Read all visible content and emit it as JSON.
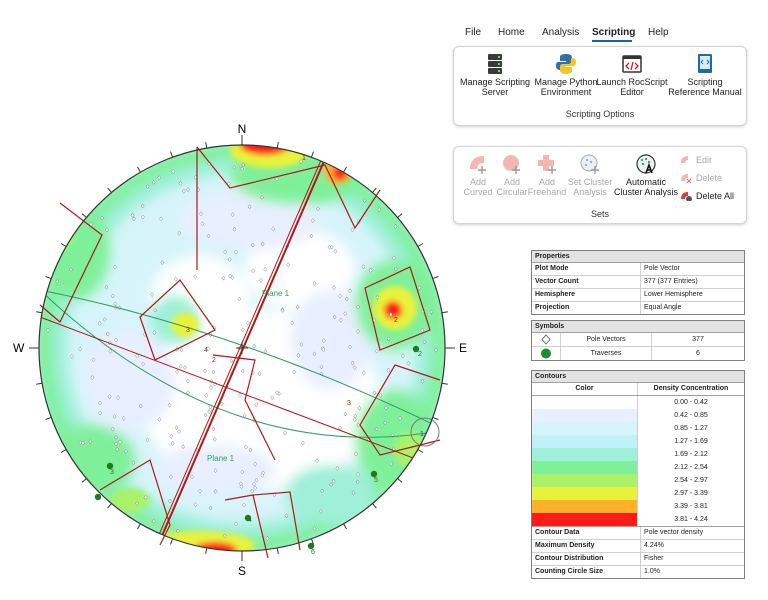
{
  "ribbon": {
    "menu": [
      {
        "label": "File",
        "active": false
      },
      {
        "label": "Home",
        "active": false
      },
      {
        "label": "Analysis",
        "active": false
      },
      {
        "label": "Scripting",
        "active": true
      },
      {
        "label": "Help",
        "active": false
      }
    ],
    "scripting": {
      "buttons": [
        {
          "line1": "Manage Scripting",
          "line2": "Server",
          "icon": "server-icon"
        },
        {
          "line1": "Manage Python",
          "line2": "Environment",
          "icon": "python-icon"
        },
        {
          "line1": "Launch RocScript",
          "line2": "Editor",
          "icon": "code-editor-icon"
        },
        {
          "line1": "Scripting",
          "line2": "Reference Manual",
          "icon": "manual-icon"
        }
      ],
      "group_label": "Scripting Options"
    },
    "sets": {
      "buttons": [
        {
          "line1": "Add",
          "line2": "Curved",
          "icon": "add-curved-icon",
          "enabled": false
        },
        {
          "line1": "Add",
          "line2": "Circular",
          "icon": "add-circular-icon",
          "enabled": false
        },
        {
          "line1": "Add",
          "line2": "Freehand",
          "icon": "add-freehand-icon",
          "enabled": false
        },
        {
          "line1": "Set Cluster",
          "line2": "Analysis",
          "icon": "cluster-analysis-icon",
          "enabled": false
        },
        {
          "line1": "Automatic",
          "line2": "Cluster Analysis",
          "icon": "auto-cluster-icon",
          "enabled": true
        }
      ],
      "side_buttons": [
        {
          "label": "Edit",
          "icon": "edit-icon",
          "enabled": false
        },
        {
          "label": "Delete",
          "icon": "delete-icon",
          "enabled": false
        },
        {
          "label": "Delete All",
          "icon": "delete-all-icon",
          "enabled": true
        }
      ],
      "group_label": "Sets"
    }
  },
  "stereonet": {
    "compass": {
      "n": "N",
      "e": "E",
      "s": "S",
      "w": "W"
    },
    "plane_labels": [
      "Plane 1",
      "Plane 1"
    ],
    "set_labels": [
      "1",
      "2",
      "3",
      "4",
      "2",
      "1",
      "3",
      "2",
      "3",
      "4",
      "5",
      "6"
    ],
    "colors": {
      "set_window": "#b01818",
      "plane_line": "#2e9e62",
      "traverse": "#1f7a1f"
    }
  },
  "properties": {
    "title": "Properties",
    "rows": [
      {
        "key": "Plot Mode",
        "value": "Pole Vector"
      },
      {
        "key": "Vector Count",
        "value": "377 (377 Entries)"
      },
      {
        "key": "Hemisphere",
        "value": "Lower Hemisphere"
      },
      {
        "key": "Projection",
        "value": "Equal Angle"
      }
    ]
  },
  "symbols": {
    "title": "Symbols",
    "rows": [
      {
        "label": "Pole Vectors",
        "value": "377",
        "icon": "diamond-icon"
      },
      {
        "label": "Traverses",
        "value": "6",
        "icon": "green-circle-icon"
      }
    ]
  },
  "contours": {
    "title": "Contours",
    "col_color": "Color",
    "col_density": "Density Concentration",
    "legend": [
      {
        "range": "0.00 - 0.42",
        "color": "#ffffff"
      },
      {
        "range": "0.42 - 0.85",
        "color": "#e8efff"
      },
      {
        "range": "0.85 - 1.27",
        "color": "#d6f4fa"
      },
      {
        "range": "1.27 - 1.69",
        "color": "#bff2f6"
      },
      {
        "range": "1.69 - 2.12",
        "color": "#9ef0d8"
      },
      {
        "range": "2.12 - 2.54",
        "color": "#7ff09a"
      },
      {
        "range": "2.54 - 2.97",
        "color": "#a9f26a"
      },
      {
        "range": "2.97 - 3.39",
        "color": "#e8f23a"
      },
      {
        "range": "3.39 - 3.81",
        "color": "#ffb12a"
      },
      {
        "range": "3.81 - 4.24",
        "color": "#ff1a1a"
      }
    ],
    "rows": [
      {
        "key": "Contour Data",
        "value": "Pole vector density"
      },
      {
        "key": "Maximum Density",
        "value": "4.24%"
      },
      {
        "key": "Contour Distribution",
        "value": "Fisher"
      },
      {
        "key": "Counting Circle Size",
        "value": "1.0%"
      }
    ]
  }
}
